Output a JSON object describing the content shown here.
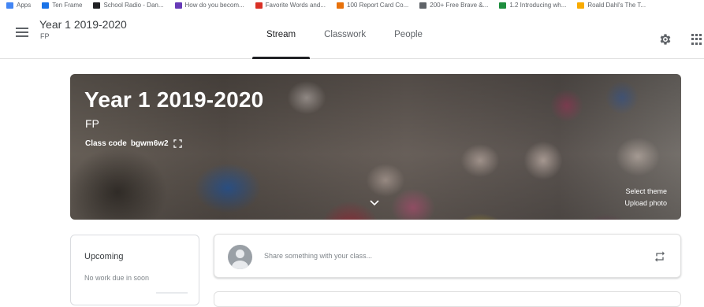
{
  "bookmarks": [
    {
      "label": "Apps",
      "color": "#4285f4"
    },
    {
      "label": "Ten Frame",
      "color": "#1a73e8"
    },
    {
      "label": "School Radio - Dan...",
      "color": "#202124"
    },
    {
      "label": "How do you becom...",
      "color": "#673ab7"
    },
    {
      "label": "Favorite Words and...",
      "color": "#d93025"
    },
    {
      "label": "100 Report Card Co...",
      "color": "#e8710a"
    },
    {
      "label": "200+ Free Brave &...",
      "color": "#5f6368"
    },
    {
      "label": "1.2 Introducing  wh...",
      "color": "#1e8e3e"
    },
    {
      "label": "Roald Dahl's The T...",
      "color": "#f9ab00"
    }
  ],
  "header": {
    "class_name": "Year 1 2019-2020",
    "section": "FP",
    "tabs": [
      {
        "label": "Stream",
        "active": true
      },
      {
        "label": "Classwork",
        "active": false
      },
      {
        "label": "People",
        "active": false
      }
    ]
  },
  "banner": {
    "title": "Year 1 2019-2020",
    "section": "FP",
    "class_code_label": "Class code",
    "class_code": "bgwm6w2",
    "select_theme": "Select theme",
    "upload_photo": "Upload photo"
  },
  "upcoming": {
    "title": "Upcoming",
    "message": "No work due in soon"
  },
  "share": {
    "placeholder": "Share something with your class..."
  },
  "colors": {
    "accent": "#202124",
    "border": "#dadce0",
    "muted_text": "#80868b"
  }
}
